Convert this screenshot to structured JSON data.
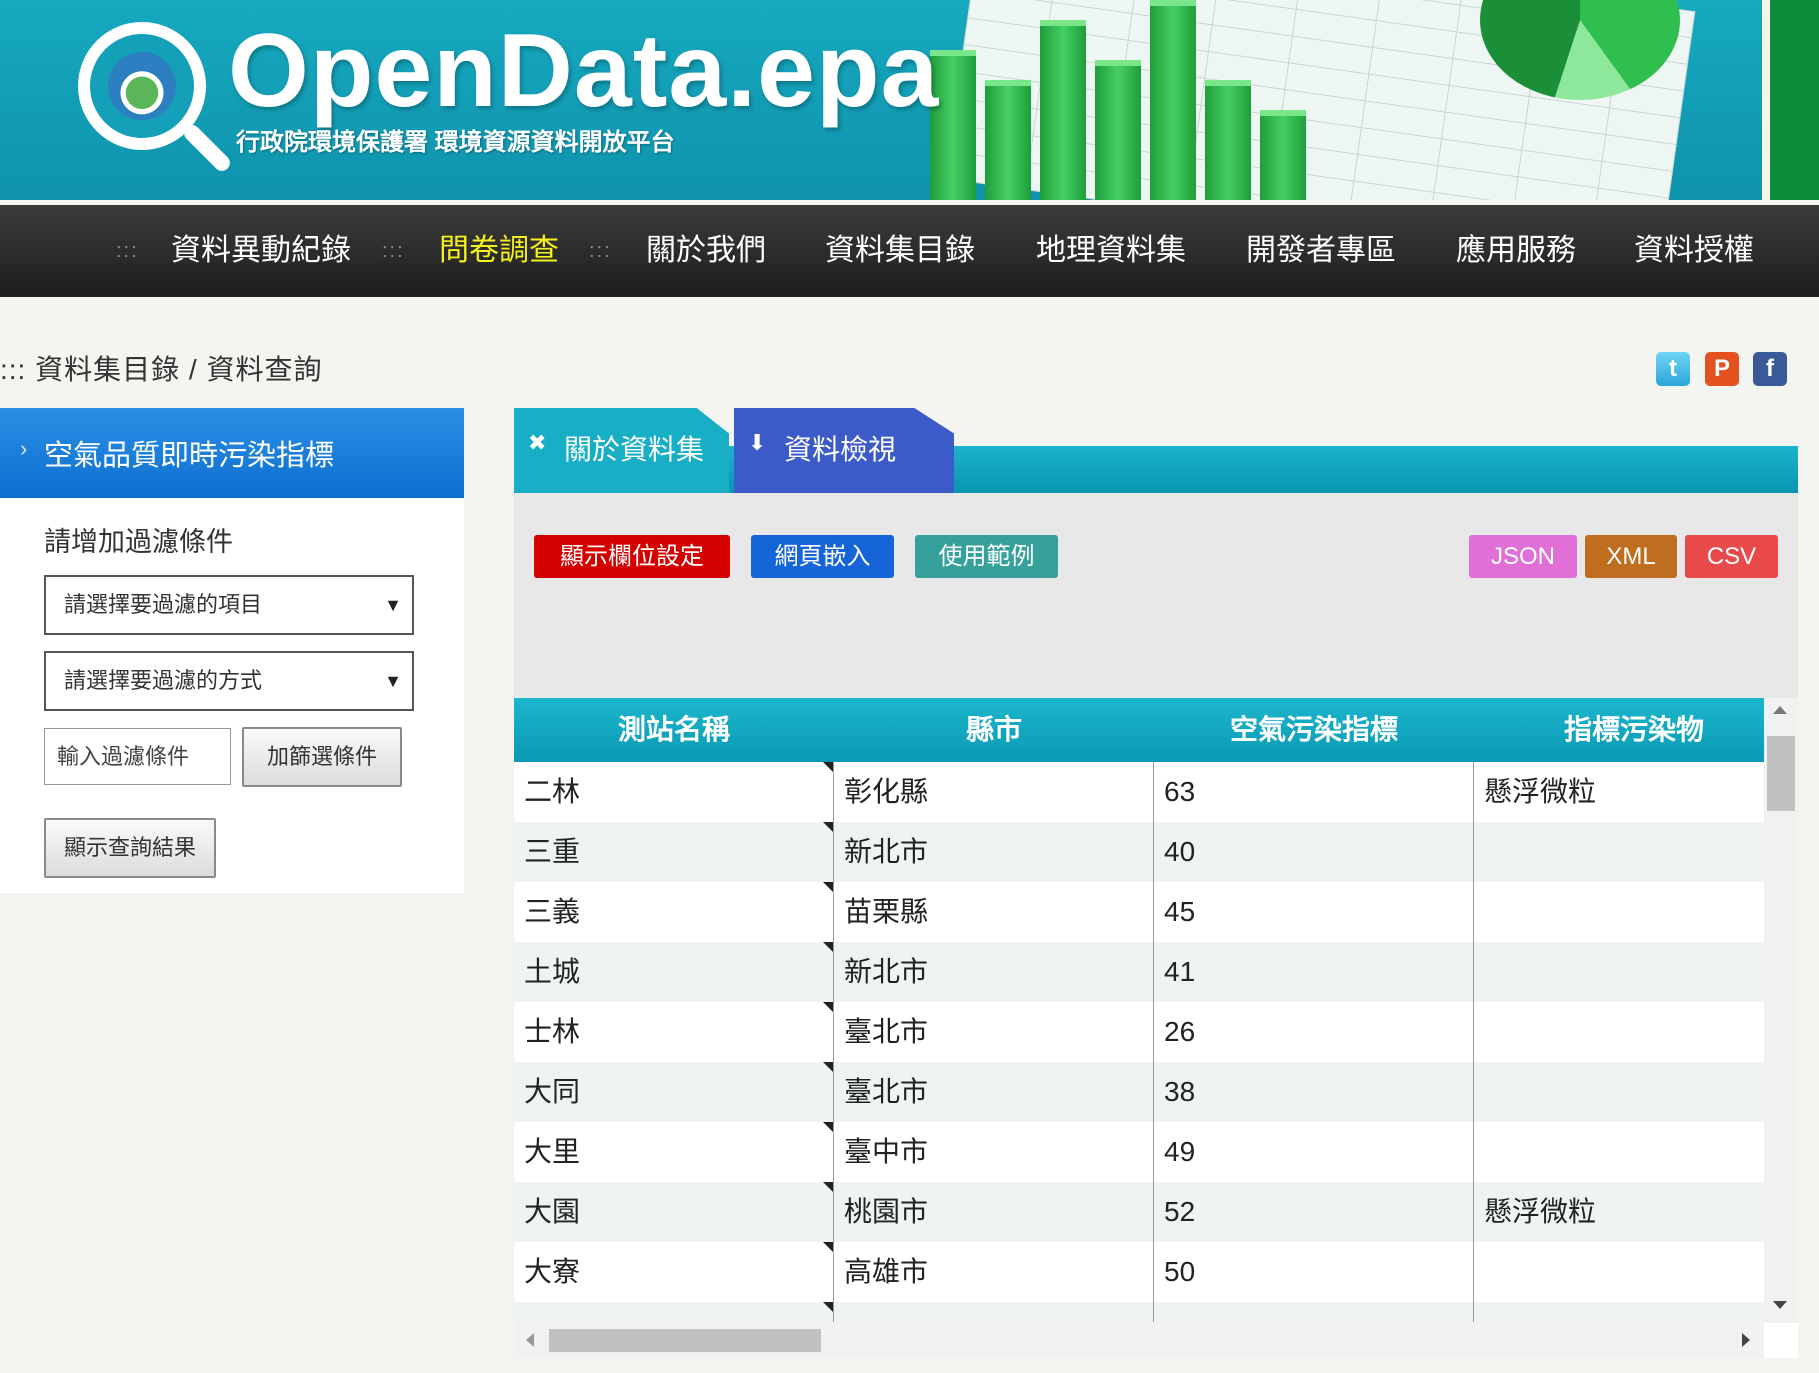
{
  "banner": {
    "title": "OpenData.epa",
    "subtitle": "行政院環境保護署 環境資源資料開放平台"
  },
  "nav": {
    "separator": ":::",
    "items": [
      {
        "label": "資料異動紀錄"
      },
      {
        "label": "問卷調查",
        "active": true
      },
      {
        "label": "關於我們"
      },
      {
        "label": "資料集目錄"
      },
      {
        "label": "地理資料集"
      },
      {
        "label": "開發者專區"
      },
      {
        "label": "應用服務"
      },
      {
        "label": "資料授權"
      }
    ]
  },
  "breadcrumb": {
    "prefix": ":::",
    "parent": "資料集目錄",
    "divider": "/",
    "current": "資料查詢"
  },
  "social": {
    "twitter": "t",
    "plurk": "P",
    "facebook": "f"
  },
  "sidebar": {
    "title": "空氣品質即時污染指標",
    "filter_label": "請增加過濾條件",
    "select_item_placeholder": "請選擇要過濾的項目",
    "select_method_placeholder": "請選擇要過濾的方式",
    "input_placeholder": "輸入過濾條件",
    "add_filter_button": "加篩選條件",
    "show_results_button": "顯示查詢結果"
  },
  "tabs": {
    "about": "關於資料集",
    "preview": "資料檢視"
  },
  "toolbar": {
    "column_settings": "顯示欄位設定",
    "embed": "網頁嵌入",
    "examples": "使用範例",
    "json": "JSON",
    "xml": "XML",
    "csv": "CSV"
  },
  "colors": {
    "accent_teal": "#0fa3bd",
    "nav_active": "#f6f21c",
    "btn_red": "#d40000",
    "btn_blue": "#1565d8",
    "btn_teal": "#36a09a",
    "json": "#e070d8",
    "xml": "#bf6d1e",
    "csv": "#e84a4a"
  },
  "table": {
    "columns": [
      "測站名稱",
      "縣市",
      "空氣污染指標",
      "指標污染物"
    ],
    "rows": [
      [
        "二林",
        "彰化縣",
        "63",
        "懸浮微粒"
      ],
      [
        "三重",
        "新北市",
        "40",
        ""
      ],
      [
        "三義",
        "苗栗縣",
        "45",
        ""
      ],
      [
        "土城",
        "新北市",
        "41",
        ""
      ],
      [
        "士林",
        "臺北市",
        "26",
        ""
      ],
      [
        "大同",
        "臺北市",
        "38",
        ""
      ],
      [
        "大里",
        "臺中市",
        "49",
        ""
      ],
      [
        "大園",
        "桃園市",
        "52",
        "懸浮微粒"
      ],
      [
        "大寮",
        "高雄市",
        "50",
        ""
      ]
    ]
  }
}
